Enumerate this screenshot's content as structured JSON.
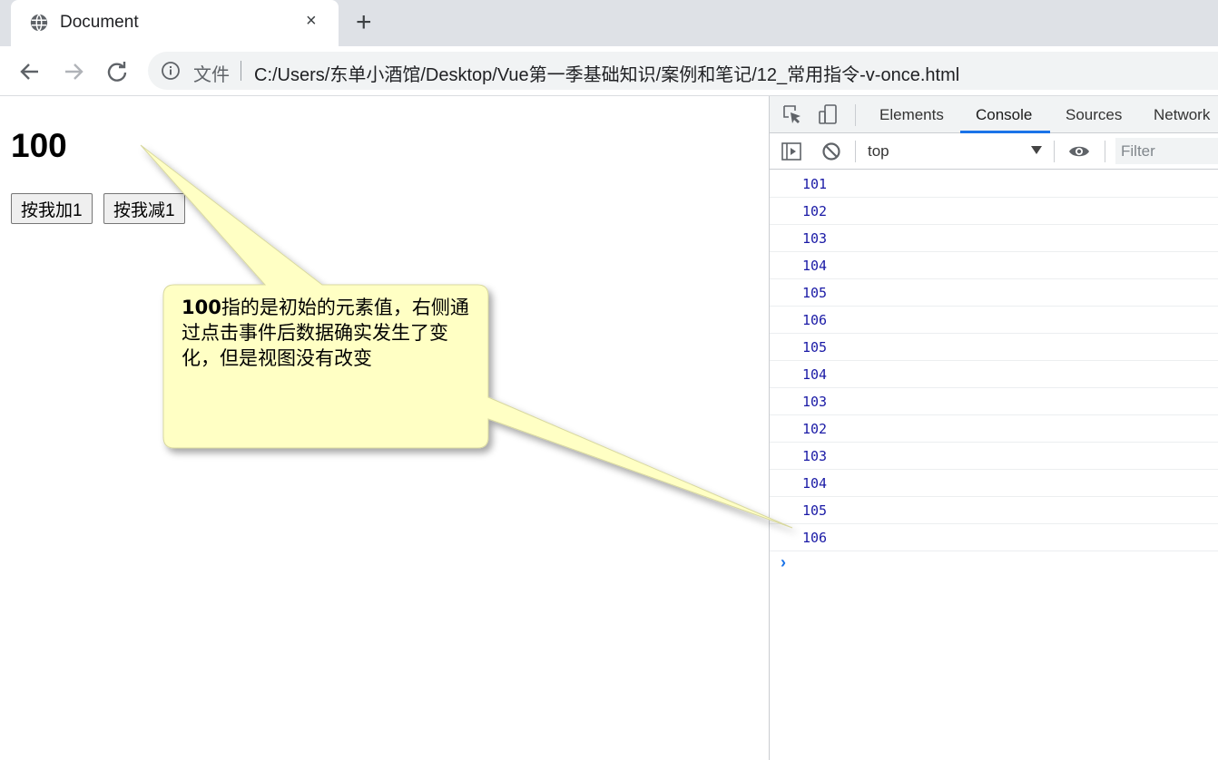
{
  "browser": {
    "tab_title": "Document",
    "tab_close": "×",
    "new_tab": "+",
    "address_chip": "文件",
    "url": "C:/Users/东单小酒馆/Desktop/Vue第一季基础知识/案例和笔记/12_常用指令-v-once.html"
  },
  "page": {
    "counter_value": "100",
    "buttons": [
      {
        "label": "按我加1"
      },
      {
        "label": "按我减1"
      }
    ]
  },
  "devtools": {
    "tabs": [
      {
        "label": "Elements",
        "active": false
      },
      {
        "label": "Console",
        "active": true
      },
      {
        "label": "Sources",
        "active": false
      },
      {
        "label": "Network",
        "active": false
      }
    ],
    "context": "top",
    "filter_placeholder": "Filter",
    "log_lines": [
      "101",
      "102",
      "103",
      "104",
      "105",
      "106",
      "105",
      "104",
      "103",
      "102",
      "103",
      "104",
      "105",
      "106"
    ],
    "prompt_symbol": "›"
  },
  "annotation": {
    "lead": "100",
    "text": "指的是初始的元素值，右侧通过点击事件后数据确实发生了变化，但是视图没有改变"
  },
  "colors": {
    "accent": "#1a73e8",
    "log_text": "#1a1aa6",
    "callout_fill": "#ffffc4"
  }
}
